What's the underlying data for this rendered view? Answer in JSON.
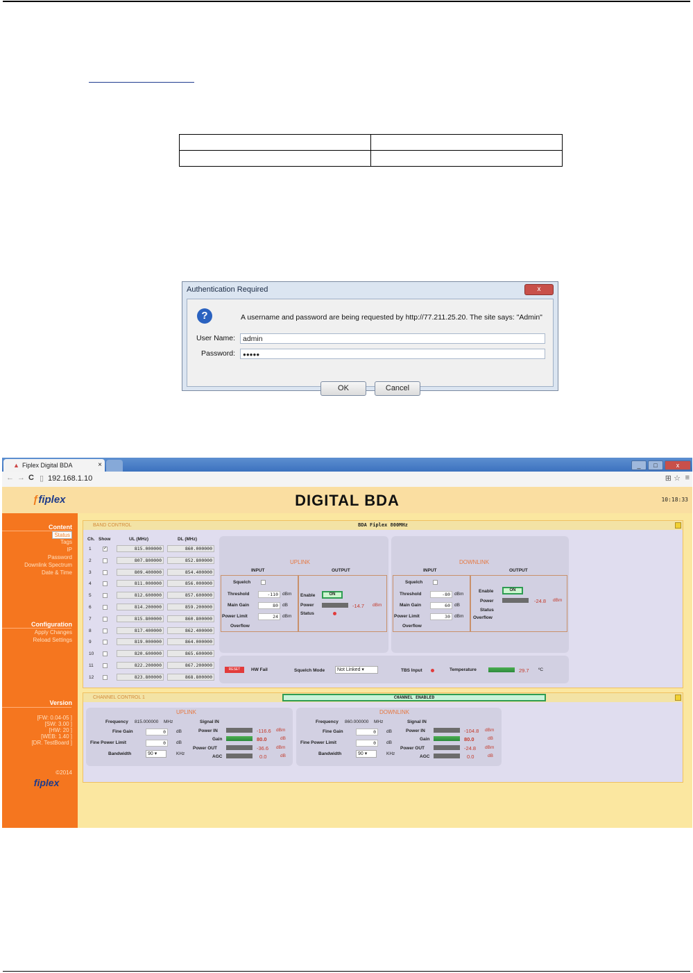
{
  "auth_dialog": {
    "title": "Authentication Required",
    "message": "A username and password are being requested by http://77.211.25.20. The site says: \"Admin\"",
    "username_label": "User Name:",
    "username_value": "admin",
    "password_label": "Password:",
    "password_value": "●●●●●",
    "ok_label": "OK",
    "cancel_label": "Cancel",
    "close_label": "x"
  },
  "browser": {
    "tab_title": "Fiplex Digital BDA",
    "tab_close": "×",
    "url": "192.168.1.10",
    "back": "←",
    "forward": "→",
    "reload": "C"
  },
  "app": {
    "title": "DIGITAL BDA",
    "clock": "10:18:33",
    "logo": "fiplex",
    "sidebar": {
      "content_header": "Content",
      "content_items": [
        "Status",
        "Tags",
        "IP",
        "Password",
        "Downlink Spectrum",
        "Date & Time"
      ],
      "config_header": "Configuration",
      "config_items": [
        "Apply Changes",
        "Reload Settings"
      ],
      "version_header": "Version",
      "version_items": [
        "[FW: 0.04-05 ]",
        "[SW: 3.00 ]",
        "[HW: 20 ]",
        "[WEB: 1.40 ]",
        "[DR. TestBoard ]"
      ],
      "copyright": "©2014"
    },
    "band_control": {
      "panel_label": "BAND CONTROL",
      "panel_title": "BDA Fiplex 800MHz",
      "headers": [
        "Ch.",
        "Show",
        "UL (MHz)",
        "DL (MHz)"
      ],
      "channels": [
        {
          "ch": "1",
          "checked": true,
          "ul": "815.000000",
          "dl": "860.000000"
        },
        {
          "ch": "2",
          "checked": false,
          "ul": "807.800000",
          "dl": "852.800000"
        },
        {
          "ch": "3",
          "checked": false,
          "ul": "809.400000",
          "dl": "854.400000"
        },
        {
          "ch": "4",
          "checked": false,
          "ul": "811.000000",
          "dl": "856.000000"
        },
        {
          "ch": "5",
          "checked": false,
          "ul": "812.600000",
          "dl": "857.600000"
        },
        {
          "ch": "6",
          "checked": false,
          "ul": "814.200000",
          "dl": "859.200000"
        },
        {
          "ch": "7",
          "checked": false,
          "ul": "815.800000",
          "dl": "860.800000"
        },
        {
          "ch": "8",
          "checked": false,
          "ul": "817.400000",
          "dl": "862.400000"
        },
        {
          "ch": "9",
          "checked": false,
          "ul": "819.000000",
          "dl": "864.000000"
        },
        {
          "ch": "10",
          "checked": false,
          "ul": "820.600000",
          "dl": "865.600000"
        },
        {
          "ch": "11",
          "checked": false,
          "ul": "822.200000",
          "dl": "867.200000"
        },
        {
          "ch": "12",
          "checked": false,
          "ul": "823.800000",
          "dl": "868.800000"
        }
      ],
      "uplink": {
        "label": "UPLINK",
        "input": "INPUT",
        "output": "OUTPUT",
        "squelch": "Squelch",
        "threshold": "Threshold",
        "threshold_val": "-110",
        "threshold_unit": "dBm",
        "main_gain": "Main Gain",
        "main_gain_val": "80",
        "main_gain_unit": "dB",
        "power_limit": "Power Limit",
        "power_limit_val": "24",
        "power_limit_unit": "dBm",
        "overflow": "Overflow",
        "enable": "Enable",
        "enable_btn": "ON",
        "power": "Power",
        "power_val": "-14.7",
        "power_unit": "dBm",
        "status": "Status"
      },
      "downlink": {
        "label": "DOWNLINK",
        "input": "INPUT",
        "output": "OUTPUT",
        "squelch": "Squelch",
        "threshold": "Threshold",
        "threshold_val": "-80",
        "threshold_unit": "dBm",
        "main_gain": "Main Gain",
        "main_gain_val": "60",
        "main_gain_unit": "dB",
        "power_limit": "Power Limit",
        "power_limit_val": "30",
        "power_limit_unit": "dBm",
        "overflow": "Overflow",
        "enable": "Enable",
        "enable_btn": "ON",
        "power": "Power",
        "power_val": "-24.8",
        "power_unit": "dBm",
        "status": "Status"
      },
      "bottom": {
        "reset": "RESET",
        "hw_fail": "HW Fail",
        "squelch_mode": "Squelch Mode",
        "squelch_mode_val": "Not Linked",
        "tbs_input": "TBS Input",
        "temperature": "Temperature",
        "temperature_val": "29.7",
        "temperature_unit": "ºC"
      }
    },
    "channel_control": {
      "panel_label": "CHANNEL CONTROL 1",
      "status": "CHANNEL ENABLED",
      "uplink": {
        "label": "UPLINK",
        "frequency": "Frequency",
        "frequency_val": "815.000000",
        "frequency_unit": "MHz",
        "fine_gain": "Fine Gain",
        "fine_gain_val": "0",
        "fine_gain_unit": "dB",
        "fine_power_limit": "Fine Power Limit",
        "fine_power_limit_val": "0",
        "fine_power_limit_unit": "dB",
        "bandwidth": "Bandwidth",
        "bandwidth_val": "90",
        "bandwidth_unit": "KHz",
        "signal_in": "Signal IN",
        "power_in": "Power IN",
        "power_in_val": "-116.6",
        "power_in_unit": "dBm",
        "gain": "Gain",
        "gain_val": "80.0",
        "gain_unit": "dB",
        "power_out": "Power OUT",
        "power_out_val": "-36.6",
        "power_out_unit": "dBm",
        "agc": "AGC",
        "agc_val": "0.0",
        "agc_unit": "dB"
      },
      "downlink": {
        "label": "DOWNLINK",
        "frequency": "Frequency",
        "frequency_val": "860.000000",
        "frequency_unit": "MHz",
        "fine_gain": "Fine Gain",
        "fine_gain_val": "0",
        "fine_gain_unit": "dB",
        "fine_power_limit": "Fine Power Limit",
        "fine_power_limit_val": "0",
        "fine_power_limit_unit": "dB",
        "bandwidth": "Bandwidth",
        "bandwidth_val": "90",
        "bandwidth_unit": "KHz",
        "signal_in": "Signal IN",
        "power_in": "Power IN",
        "power_in_val": "-104.8",
        "power_in_unit": "dBm",
        "gain": "Gain",
        "gain_val": "80.0",
        "gain_unit": "dB",
        "power_out": "Power OUT",
        "power_out_val": "-24.8",
        "power_out_unit": "dBm",
        "agc": "AGC",
        "agc_val": "0.0",
        "agc_unit": "dB"
      }
    }
  },
  "colors": {
    "sidebar": "#f5761f",
    "page_bg": "#fbe7a0",
    "panel_bg": "#e0ddef",
    "enabled_green": "#2e9c52",
    "value_red": "#c43a2a"
  }
}
